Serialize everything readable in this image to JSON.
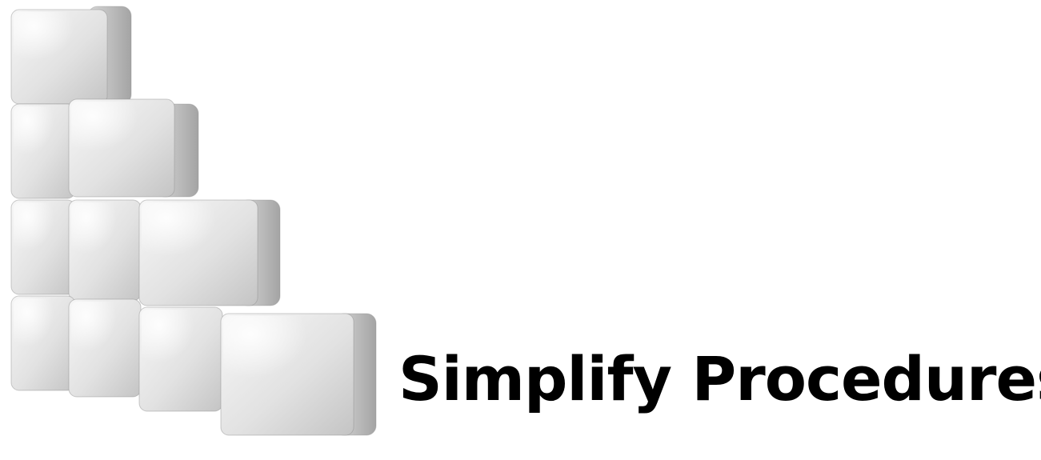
{
  "headline": {
    "text": "Simplify Procedures",
    "color": "#000000"
  },
  "illustration": {
    "icon": "stacked-cubes-staircase-icon",
    "rows": [
      4,
      3,
      2,
      1
    ],
    "cube_colors": {
      "front_light": "#f1f1f1",
      "front_dark": "#c9c9c9",
      "side_light": "#cfcfcf",
      "side_dark": "#a6a6a6",
      "top": "#e4e4e4",
      "edge": "#8d8d8d"
    }
  }
}
